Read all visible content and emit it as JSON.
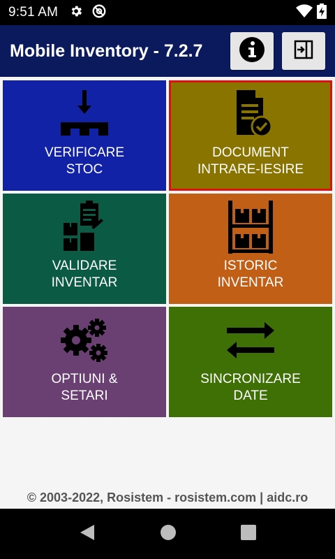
{
  "status_bar": {
    "time": "9:51 AM",
    "icons": [
      "gear-icon",
      "at-sign-icon",
      "wifi-icon",
      "battery-charging-icon"
    ]
  },
  "app_bar": {
    "title": "Mobile Inventory - 7.2.7",
    "actions": [
      {
        "name": "info",
        "icon": "info-icon"
      },
      {
        "name": "logout",
        "icon": "exit-icon"
      }
    ],
    "background": "#0b1a5c"
  },
  "tiles": [
    {
      "label": "VERIFICARE\nSTOC",
      "icon": "unload-pallet-icon",
      "color": "#1222a6"
    },
    {
      "label": "DOCUMENT\nINTRARE-IESIRE",
      "icon": "document-check-icon",
      "color": "#8a7400",
      "selected": true
    },
    {
      "label": "VALIDARE\nINVENTAR",
      "icon": "clipboard-boxes-icon",
      "color": "#0a5a44"
    },
    {
      "label": "ISTORIC\nINVENTAR",
      "icon": "warehouse-shelf-icon",
      "color": "#c25f17"
    },
    {
      "label": "OPTIUNI &\nSETARI",
      "icon": "gears-icon",
      "color": "#6a3f72"
    },
    {
      "label": "SINCRONIZARE\nDATE",
      "icon": "sync-arrows-icon",
      "color": "#3f7005"
    }
  ],
  "footer": {
    "text": "© 2003-2022, Rosistem - rosistem.com | aidc.ro"
  },
  "nav_bar": {
    "buttons": [
      "back-icon",
      "home-icon",
      "recents-icon"
    ]
  },
  "colors": {
    "selection_border": "#e01010"
  }
}
